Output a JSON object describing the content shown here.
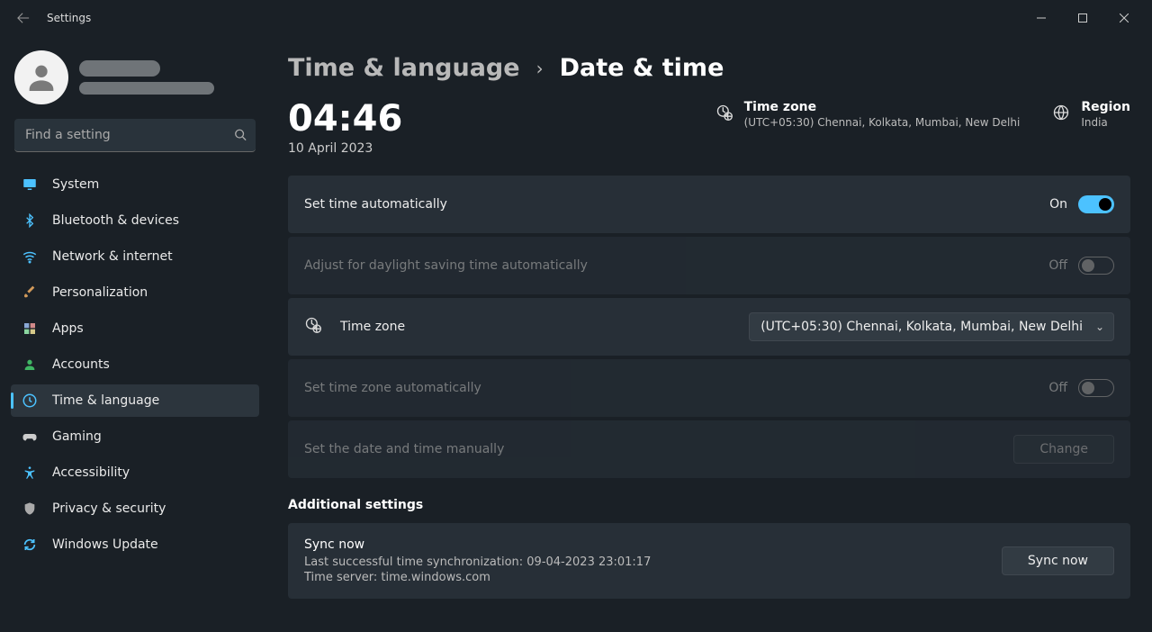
{
  "window": {
    "title": "Settings"
  },
  "search": {
    "placeholder": "Find a setting"
  },
  "nav": {
    "items": [
      {
        "label": "System"
      },
      {
        "label": "Bluetooth & devices"
      },
      {
        "label": "Network & internet"
      },
      {
        "label": "Personalization"
      },
      {
        "label": "Apps"
      },
      {
        "label": "Accounts"
      },
      {
        "label": "Time & language"
      },
      {
        "label": "Gaming"
      },
      {
        "label": "Accessibility"
      },
      {
        "label": "Privacy & security"
      },
      {
        "label": "Windows Update"
      }
    ]
  },
  "breadcrumb": {
    "parent": "Time & language",
    "current": "Date & time"
  },
  "clock": {
    "time": "04:46",
    "date": "10 April 2023"
  },
  "hdr": {
    "tz_label": "Time zone",
    "tz_value": "(UTC+05:30) Chennai, Kolkata, Mumbai, New Delhi",
    "region_label": "Region",
    "region_value": "India"
  },
  "rows": {
    "auto_time": {
      "label": "Set time automatically",
      "state": "On"
    },
    "dst": {
      "label": "Adjust for daylight saving time automatically",
      "state": "Off"
    },
    "tz": {
      "label": "Time zone",
      "value": "(UTC+05:30) Chennai, Kolkata, Mumbai, New Delhi"
    },
    "auto_tz": {
      "label": "Set time zone automatically",
      "state": "Off"
    },
    "manual": {
      "label": "Set the date and time manually",
      "button": "Change"
    }
  },
  "additional": {
    "heading": "Additional settings"
  },
  "sync": {
    "title": "Sync now",
    "last": "Last successful time synchronization: 09-04-2023 23:01:17",
    "server": "Time server: time.windows.com",
    "button": "Sync now"
  }
}
